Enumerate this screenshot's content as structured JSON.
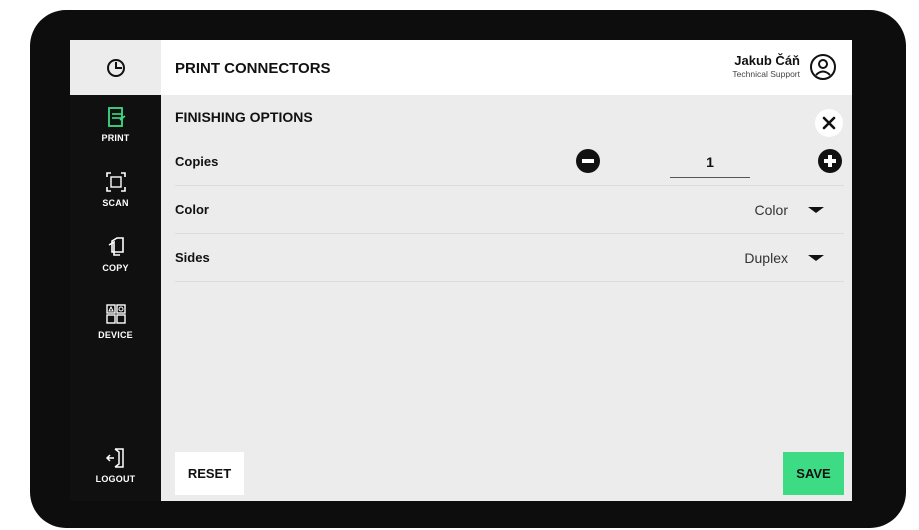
{
  "header": {
    "title": "PRINT CONNECTORS",
    "user_name": "Jakub Čáň",
    "user_role": "Technical Support"
  },
  "sidebar": {
    "items": [
      {
        "label": "PRINT",
        "icon": "print-icon",
        "active": true
      },
      {
        "label": "SCAN",
        "icon": "scan-icon",
        "active": false
      },
      {
        "label": "COPY",
        "icon": "copy-icon",
        "active": false
      },
      {
        "label": "DEVICE",
        "icon": "device-icon",
        "active": false
      }
    ],
    "logout_label": "LOGOUT"
  },
  "main": {
    "section_title": "FINISHING OPTIONS",
    "copies": {
      "label": "Copies",
      "value": "1"
    },
    "color": {
      "label": "Color",
      "selected": "Color"
    },
    "sides": {
      "label": "Sides",
      "selected": "Duplex"
    }
  },
  "footer": {
    "reset_label": "RESET",
    "save_label": "SAVE"
  },
  "colors": {
    "accent": "#3ddc84",
    "sidebar_bg": "#101010",
    "content_bg": "#ececec"
  }
}
